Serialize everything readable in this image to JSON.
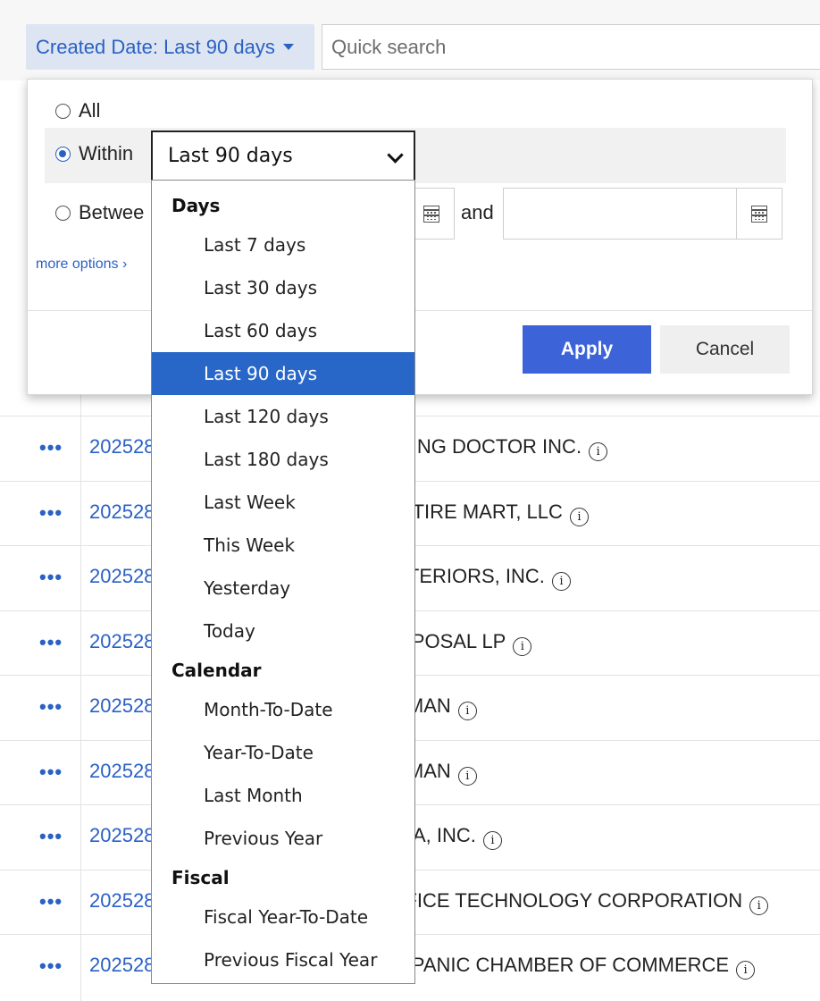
{
  "toolbar": {
    "filter_chip_label": "Created Date: Last 90 days",
    "quick_search_placeholder": "Quick search"
  },
  "rows": [
    {
      "id": "202528",
      "name": "IBING DOCTOR INC."
    },
    {
      "id": "202528",
      "name": "N TIRE MART, LLC"
    },
    {
      "id": "202528",
      "name": "NTERIORS, INC."
    },
    {
      "id": "202528",
      "name": "ISPOSAL LP"
    },
    {
      "id": "202528",
      "name": "DMAN"
    },
    {
      "id": "202528",
      "name": "DMAN"
    },
    {
      "id": "202528",
      "name": "DIA, INC."
    },
    {
      "id": "202528",
      "name": "FFICE TECHNOLOGY CORPORATION"
    },
    {
      "id": "202528",
      "name": "ISPANIC CHAMBER OF COMMERCE"
    }
  ],
  "row_menu_glyph": "•••",
  "info_glyph": "i",
  "filter_panel": {
    "option_all": "All",
    "option_within": "Within",
    "option_between": "Betwee",
    "between_and": "and",
    "more_options": "more options ›",
    "apply_label": "Apply",
    "cancel_label": "Cancel",
    "selected_option": "within"
  },
  "range_select": {
    "value": "Last 90 days",
    "groups": [
      {
        "label": "Days",
        "items": [
          "Last 7 days",
          "Last 30 days",
          "Last 60 days",
          "Last 90 days",
          "Last 120 days",
          "Last 180 days",
          "Last Week",
          "This Week",
          "Yesterday",
          "Today"
        ]
      },
      {
        "label": "Calendar",
        "items": [
          "Month-To-Date",
          "Year-To-Date",
          "Last Month",
          "Previous Year"
        ]
      },
      {
        "label": "Fiscal",
        "items": [
          "Fiscal Year-To-Date",
          "Previous Fiscal Year"
        ]
      }
    ]
  },
  "colors": {
    "accent": "#2a61c4",
    "apply_button": "#3c63d8",
    "selected_item": "#2867c8"
  }
}
